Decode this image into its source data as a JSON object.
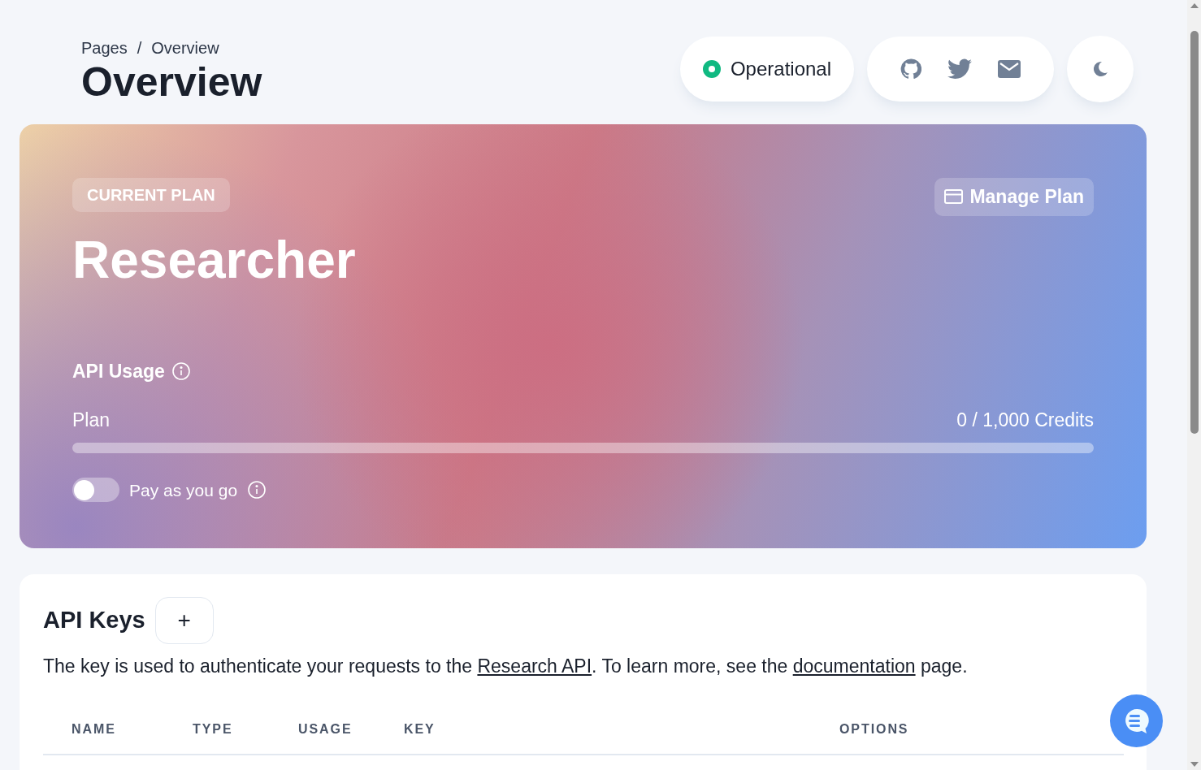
{
  "breadcrumb": {
    "items": [
      "Pages",
      "Overview"
    ],
    "separator": "/"
  },
  "title": "Overview",
  "status": {
    "label": "Operational",
    "color": "#10b981"
  },
  "plan": {
    "badge": "CURRENT PLAN",
    "name": "Researcher",
    "manage_button": "Manage Plan",
    "usage_title": "API Usage",
    "usage_label": "Plan",
    "usage_reading": "0 / 1,000 Credits",
    "level": 0,
    "pay_as_you_go": {
      "label": "Pay as you go",
      "on": false
    }
  },
  "api_keys": {
    "title": "API Keys",
    "add_button": "+",
    "description": [
      {
        "kind": "text",
        "text": "The key is used to authenticate your requests to the "
      },
      {
        "kind": "link",
        "text": "Research API"
      },
      {
        "kind": "text",
        "text": ". To learn more, see the "
      },
      {
        "kind": "link",
        "text": "documentation"
      },
      {
        "kind": "text",
        "text": " page."
      }
    ],
    "columns": [
      "NAME",
      "TYPE",
      "USAGE",
      "KEY",
      "OPTIONS"
    ]
  }
}
